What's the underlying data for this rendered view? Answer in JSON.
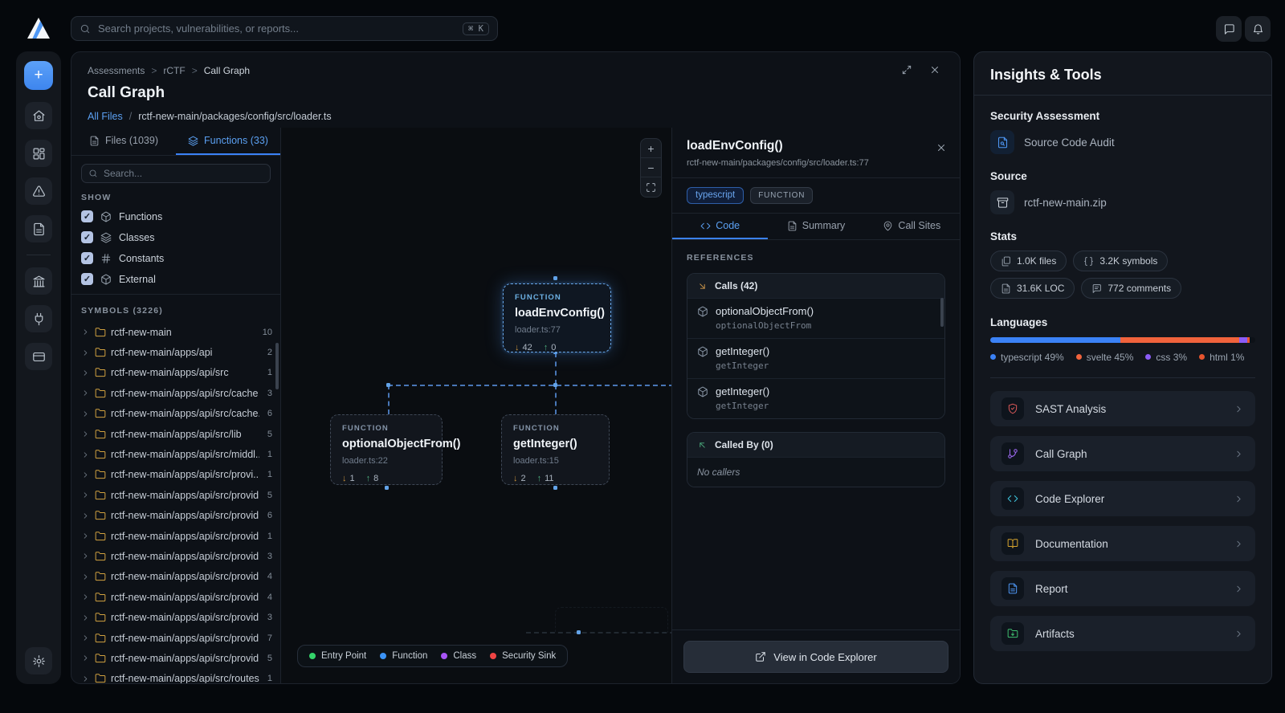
{
  "topbar": {
    "search_placeholder": "Search projects, vulnerabilities, or reports...",
    "search_shortcut": "⌘ K"
  },
  "breadcrumb": {
    "items": [
      "Assessments",
      "rCTF",
      "Call Graph"
    ],
    "separator": ">"
  },
  "header": {
    "title": "Call Graph",
    "all_files": "All Files",
    "separator": "/",
    "file_path": "rctf-new-main/packages/config/src/loader.ts"
  },
  "symbol_panel": {
    "tabs": {
      "files": "Files (1039)",
      "functions": "Functions (33)"
    },
    "search_placeholder": "Search...",
    "show_label": "SHOW",
    "filters": [
      {
        "label": "Functions"
      },
      {
        "label": "Classes"
      },
      {
        "label": "Constants"
      },
      {
        "label": "External"
      }
    ],
    "symbols_label": "SYMBOLS (3226)",
    "tree": [
      {
        "name": "rctf-new-main",
        "count": "10"
      },
      {
        "name": "rctf-new-main/apps/api",
        "count": "2"
      },
      {
        "name": "rctf-new-main/apps/api/src",
        "count": "1"
      },
      {
        "name": "rctf-new-main/apps/api/src/cache",
        "count": "3"
      },
      {
        "name": "rctf-new-main/apps/api/src/cache...",
        "count": "6"
      },
      {
        "name": "rctf-new-main/apps/api/src/lib",
        "count": "5"
      },
      {
        "name": "rctf-new-main/apps/api/src/middl...",
        "count": "1"
      },
      {
        "name": "rctf-new-main/apps/api/src/provi...",
        "count": "1"
      },
      {
        "name": "rctf-new-main/apps/api/src/provid...",
        "count": "5"
      },
      {
        "name": "rctf-new-main/apps/api/src/provid...",
        "count": "6"
      },
      {
        "name": "rctf-new-main/apps/api/src/provid...",
        "count": "1"
      },
      {
        "name": "rctf-new-main/apps/api/src/provid...",
        "count": "3"
      },
      {
        "name": "rctf-new-main/apps/api/src/provid...",
        "count": "4"
      },
      {
        "name": "rctf-new-main/apps/api/src/provid...",
        "count": "4"
      },
      {
        "name": "rctf-new-main/apps/api/src/provid...",
        "count": "3"
      },
      {
        "name": "rctf-new-main/apps/api/src/provid...",
        "count": "7"
      },
      {
        "name": "rctf-new-main/apps/api/src/provid...",
        "count": "5"
      },
      {
        "name": "rctf-new-main/apps/api/src/routes",
        "count": "1"
      }
    ]
  },
  "canvas": {
    "controls": {
      "zoom_in": "+",
      "zoom_out": "−"
    },
    "nodes": [
      {
        "type": "FUNCTION",
        "name": "loadEnvConfig()",
        "location": "loader.ts:77",
        "calls_out": "42",
        "called_by": "0"
      },
      {
        "type": "FUNCTION",
        "name": "optionalObjectFrom()",
        "location": "loader.ts:22",
        "calls_out": "1",
        "called_by": "8"
      },
      {
        "type": "FUNCTION",
        "name": "getInteger()",
        "location": "loader.ts:15",
        "calls_out": "2",
        "called_by": "11"
      }
    ],
    "legend": [
      {
        "label": "Entry Point",
        "color": "#34d46a"
      },
      {
        "label": "Function",
        "color": "#3b93f7"
      },
      {
        "label": "Class",
        "color": "#a855f7"
      },
      {
        "label": "Security Sink",
        "color": "#ef4444"
      }
    ]
  },
  "details": {
    "title": "loadEnvConfig()",
    "path": "rctf-new-main/packages/config/src/loader.ts:77",
    "badges": {
      "language": "typescript",
      "kind": "FUNCTION"
    },
    "tabs": [
      {
        "label": "Code"
      },
      {
        "label": "Summary"
      },
      {
        "label": "Call Sites"
      }
    ],
    "references_label": "REFERENCES",
    "calls": {
      "header": "Calls (42)",
      "items": [
        {
          "name": "optionalObjectFrom()",
          "symbol": "optionalObjectFrom"
        },
        {
          "name": "getInteger()",
          "symbol": "getInteger"
        },
        {
          "name": "getInteger()",
          "symbol": "getInteger"
        }
      ]
    },
    "called_by": {
      "header": "Called By (0)",
      "empty": "No callers"
    },
    "action": "View in Code Explorer"
  },
  "insights": {
    "title": "Insights & Tools",
    "assessment": {
      "label": "Security Assessment",
      "value": "Source Code Audit"
    },
    "source": {
      "label": "Source",
      "value": "rctf-new-main.zip"
    },
    "stats": {
      "label": "Stats",
      "items": [
        {
          "label": "1.0K files"
        },
        {
          "label": "3.2K symbols"
        },
        {
          "label": "31.6K LOC"
        },
        {
          "label": "772 comments"
        }
      ]
    },
    "languages": {
      "label": "Languages",
      "items": [
        {
          "name": "typescript",
          "pct": 49,
          "label": "typescript 49%",
          "color": "#3b82f6"
        },
        {
          "name": "svelte",
          "pct": 45,
          "label": "svelte 45%",
          "color": "#f1633c"
        },
        {
          "name": "css",
          "pct": 3,
          "label": "css 3%",
          "color": "#8b5cf6"
        },
        {
          "name": "html",
          "pct": 1,
          "label": "html 1%",
          "color": "#e8542e"
        }
      ]
    },
    "tools": [
      {
        "label": "SAST Analysis"
      },
      {
        "label": "Call Graph"
      },
      {
        "label": "Code Explorer"
      },
      {
        "label": "Documentation"
      },
      {
        "label": "Report"
      },
      {
        "label": "Artifacts"
      }
    ]
  }
}
